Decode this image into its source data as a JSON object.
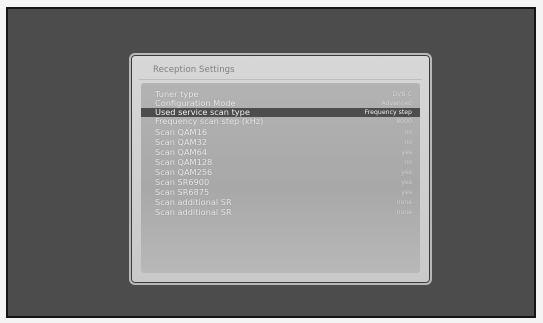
{
  "panel": {
    "title": "Reception Settings"
  },
  "settings": {
    "items": [
      {
        "label": "Tuner type",
        "value": "DVB-C"
      },
      {
        "label": "Configuration Mode",
        "value": "Advanced"
      },
      {
        "label": "Used service scan type",
        "value": "Frequency step"
      },
      {
        "label": "Frequency scan step (kHz)",
        "value": "8000"
      },
      {
        "label": "Scan QAM16",
        "value": "no"
      },
      {
        "label": "Scan QAM32",
        "value": "no"
      },
      {
        "label": "Scan QAM64",
        "value": "yes"
      },
      {
        "label": "Scan QAM128",
        "value": "no"
      },
      {
        "label": "Scan QAM256",
        "value": "yes"
      },
      {
        "label": "Scan SR6900",
        "value": "yes"
      },
      {
        "label": "Scan SR6875",
        "value": "yes"
      },
      {
        "label": "Scan additional SR",
        "value": "none"
      },
      {
        "label": "Scan additional SR",
        "value": "none"
      }
    ]
  }
}
